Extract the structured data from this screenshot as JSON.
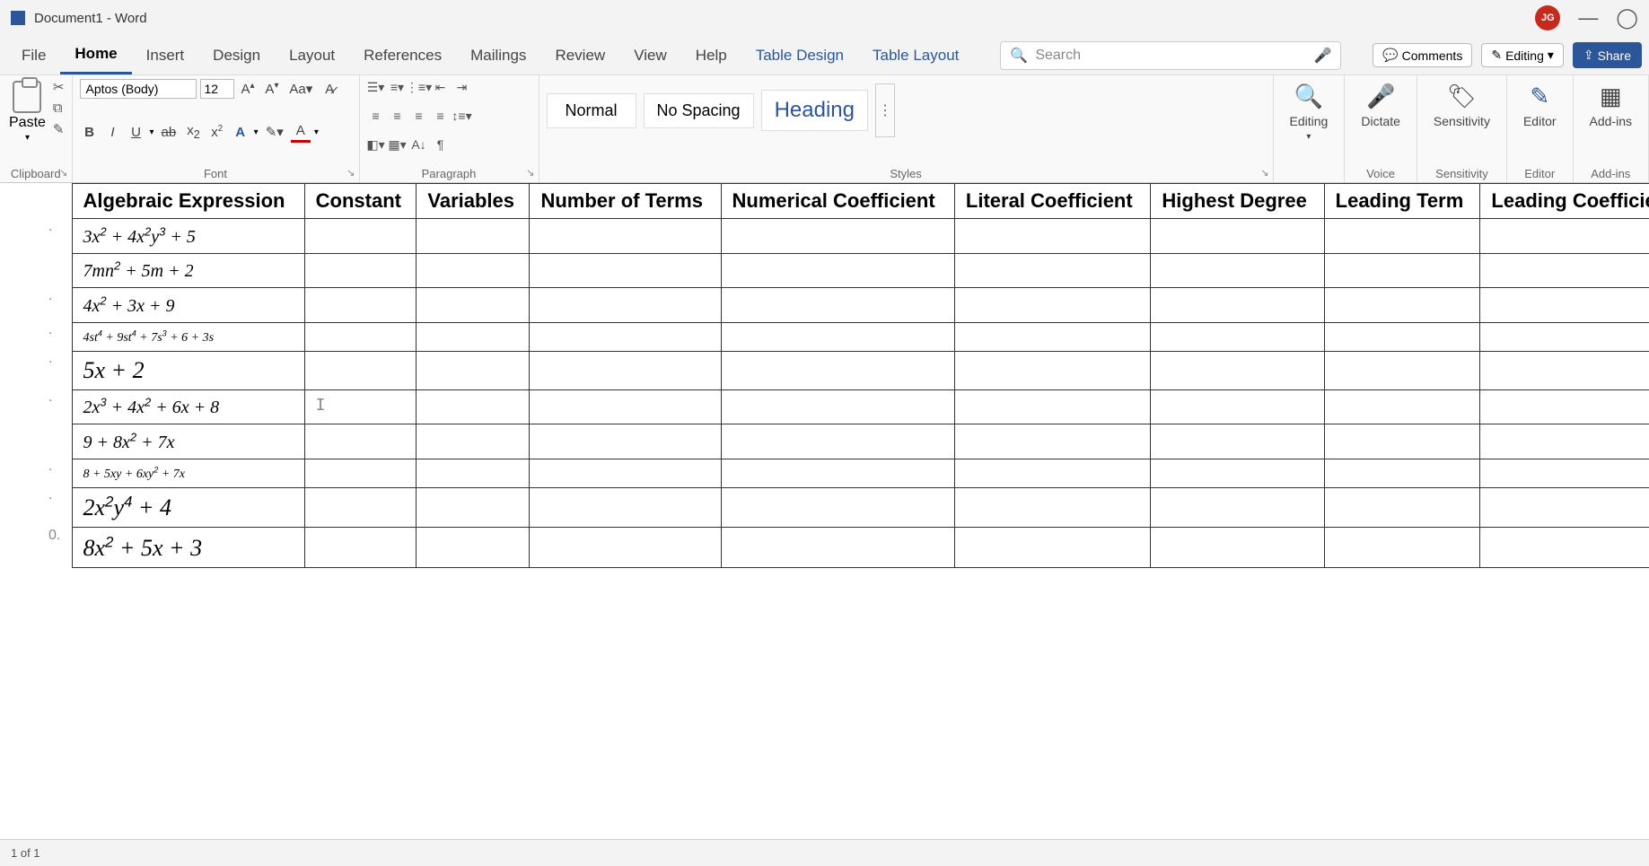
{
  "title": "Document1 - Word",
  "user_initials": "JG",
  "search_placeholder": "Search",
  "menus": {
    "file": "File",
    "home": "Home",
    "insert": "Insert",
    "design": "Design",
    "layout": "Layout",
    "references": "References",
    "mailings": "Mailings",
    "review": "Review",
    "view": "View",
    "help": "Help",
    "table_design": "Table Design",
    "table_layout": "Table Layout"
  },
  "right_actions": {
    "comments": "Comments",
    "editing": "Editing",
    "share": "Share"
  },
  "ribbon": {
    "clipboard": {
      "paste": "Paste",
      "label": "Clipboard"
    },
    "font": {
      "name": "Aptos (Body)",
      "size": "12",
      "label": "Font"
    },
    "paragraph": {
      "label": "Paragraph"
    },
    "styles": {
      "normal": "Normal",
      "no_spacing": "No Spacing",
      "heading": "Heading",
      "label": "Styles"
    },
    "editing": {
      "label": "Editing"
    },
    "voice": {
      "dictate": "Dictate",
      "label": "Voice"
    },
    "sensitivity": {
      "btn": "Sensitivity",
      "label": "Sensitivity"
    },
    "editor": {
      "btn": "Editor",
      "label": "Editor"
    },
    "addins": {
      "btn": "Add-ins",
      "label": "Add-ins"
    }
  },
  "table": {
    "headers": {
      "c1": "Algebraic Expression",
      "c2": "Constant",
      "c3": "Variables",
      "c4": "Number of Terms",
      "c5": "Numerical Coefficient",
      "c6": "Literal Coefficient",
      "c7": "Highest Degree",
      "c8": "Leading Term",
      "c9": "Leading Coefficient"
    },
    "rows": [
      {
        "marker": ".",
        "expr_html": "3x<sup>2</sup> + 4x<sup>2</sup>y<sup>3</sup> + 5",
        "cls": ""
      },
      {
        "marker": "",
        "expr_html": "7mn<sup>2</sup> + 5m + 2",
        "cls": ""
      },
      {
        "marker": ".",
        "expr_html": "4x<sup>2</sup> + 3x + 9",
        "cls": ""
      },
      {
        "marker": ".",
        "expr_html": "4st<sup>4</sup> + 9st<sup>4</sup> + 7s<sup>3</sup> + 6 + 3s",
        "cls": "small"
      },
      {
        "marker": ".",
        "expr_html": "5x + 2",
        "cls": "big"
      },
      {
        "marker": ".",
        "expr_html": "2x<sup>3</sup> + 4x<sup>2</sup> + 6x + 8",
        "cls": "",
        "cursor": true
      },
      {
        "marker": "",
        "expr_html": "9 + 8x<sup>2</sup> + 7x",
        "cls": ""
      },
      {
        "marker": ".",
        "expr_html": "8 + 5xy + 6xy<sup>2</sup> + 7x",
        "cls": "small"
      },
      {
        "marker": ".",
        "expr_html": "2x<sup>2</sup>y<sup>4</sup> + 4",
        "cls": "big"
      },
      {
        "marker": "0.",
        "expr_html": "8x<sup>2</sup> + 5x + 3",
        "cls": "big"
      }
    ]
  },
  "statusbar": {
    "page": "1 of 1"
  }
}
